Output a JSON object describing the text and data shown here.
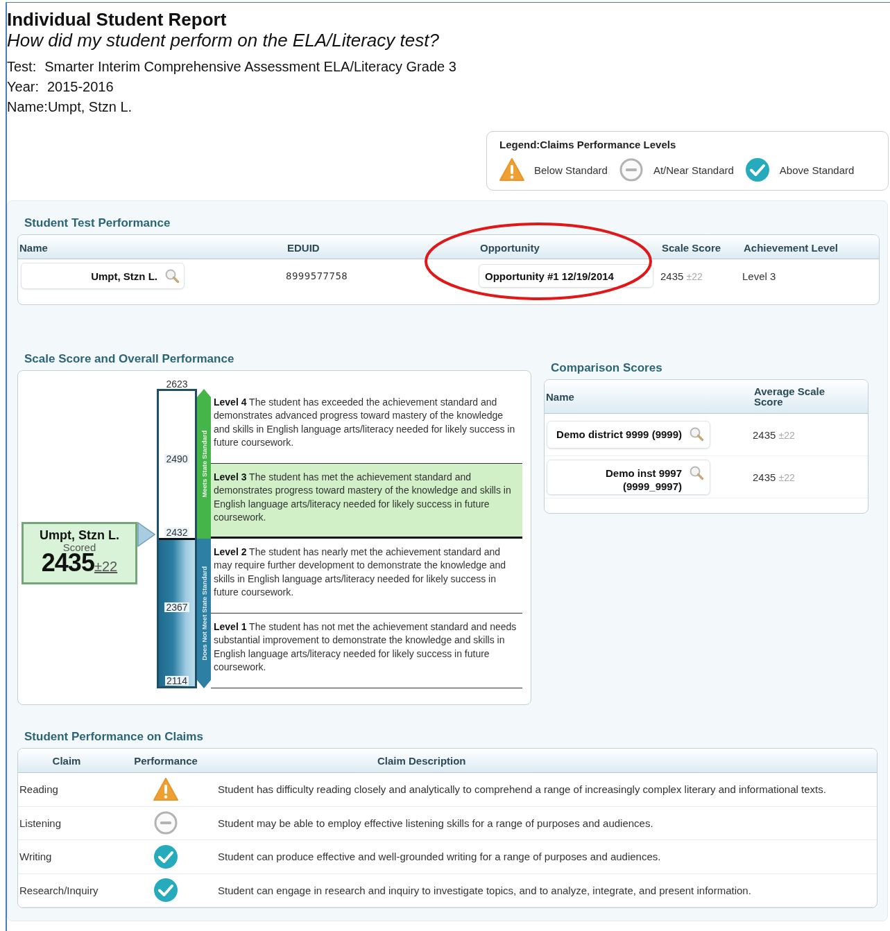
{
  "report": {
    "title": "Individual Student Report",
    "subtitle": "How did my student perform on the ELA/Literacy test?",
    "info": [
      {
        "label": "Test:",
        "value": "Smarter Interim Comprehensive Assessment ELA/Literacy Grade 3"
      },
      {
        "label": "Year:",
        "value": "2015-2016"
      },
      {
        "label": "Name:",
        "value": "Umpt, Stzn L."
      }
    ]
  },
  "legend": {
    "title": "Legend:Claims Performance Levels",
    "items": [
      {
        "kind": "below",
        "label": "Below Standard"
      },
      {
        "kind": "near",
        "label": "At/Near Standard"
      },
      {
        "kind": "above",
        "label": "Above Standard"
      }
    ]
  },
  "test_performance": {
    "title": "Student Test Performance",
    "columns": [
      "Name",
      "EDUID",
      "Opportunity",
      "Scale Score",
      "Achievement Level"
    ],
    "row": {
      "name": "Umpt, Stzn L.",
      "eduid": "8999577758",
      "opportunity": "Opportunity #1 12/19/2014",
      "score": "2435",
      "error": "±22",
      "achievement_level": "Level 3"
    }
  },
  "scale_performance": {
    "title": "Scale Score and Overall Performance",
    "student": {
      "name": "Umpt, Stzn L.",
      "scored_label": "Scored",
      "score": "2435",
      "error": "±22"
    },
    "top_cut": "2623",
    "bar": {
      "level": 0.5
    },
    "arrows": [
      {
        "kind": "meets",
        "label": "Meets State Standard"
      },
      {
        "kind": "not_meets",
        "label": "Does Not Meet State Standard"
      }
    ],
    "levels": [
      {
        "name": "Level 4",
        "description": "The student has exceeded the achievement standard and demonstrates advanced progress toward mastery of the knowledge and skills in English language arts/literacy needed for likely success in future coursework.",
        "cut": "2490",
        "selected": false
      },
      {
        "name": "Level 3",
        "description": "The student has met the achievement standard and demonstrates progress toward mastery of the knowledge and skills in English language arts/literacy needed for likely success in future coursework.",
        "cut": "2432",
        "selected": true
      },
      {
        "name": "Level 2",
        "description": "The student has nearly met the achievement standard and may require further development to demonstrate the knowledge and skills in English language arts/literacy needed for likely success in future coursework.",
        "cut": "2367",
        "selected": false
      },
      {
        "name": "Level 1",
        "description": "The student has not met the achievement standard and needs substantial improvement to demonstrate the knowledge and skills in English language arts/literacy needed for likely success in future coursework.",
        "cut": "2114",
        "selected": false
      }
    ]
  },
  "comparison": {
    "title": "Comparison Scores",
    "columns": [
      "Name",
      "Average Scale Score"
    ],
    "rows": [
      {
        "name_lines": [
          "Demo district 9999 (9999)"
        ],
        "score": "2435",
        "error": "±22"
      },
      {
        "name_lines": [
          "Demo inst 9997",
          "(9999_9997)"
        ],
        "score": "2435",
        "error": "±22"
      }
    ]
  },
  "claims": {
    "title": "Student Performance on Claims",
    "columns": [
      "Claim",
      "Performance",
      "Claim Description"
    ],
    "rows": [
      {
        "claim": "Reading",
        "kind": "below",
        "description": "Student has difficulty reading closely and analytically to comprehend a range of increasingly complex literary and informational texts."
      },
      {
        "claim": "Listening",
        "kind": "near",
        "description": "Student may be able to employ effective listening skills for a range of purposes and audiences."
      },
      {
        "claim": "Writing",
        "kind": "above",
        "description": "Student can produce effective and well-grounded writing for a range of purposes and audiences."
      },
      {
        "claim": "Research/Inquiry",
        "kind": "above",
        "description": "Student can engage in research and inquiry to investigate topics, and to analyze, integrate, and present information."
      }
    ]
  }
}
